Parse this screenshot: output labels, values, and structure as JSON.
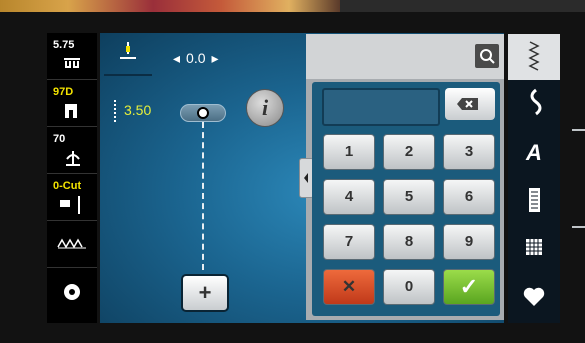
{
  "sidebar": {
    "items": [
      {
        "top": "5.75",
        "icon": "presser-foot-pressure-icon",
        "glyph": "ꝏ"
      },
      {
        "top": "97D",
        "icon": "presser-foot-icon",
        "glyph": "▐▌"
      },
      {
        "top": "70",
        "icon": "thread-tension-icon",
        "glyph": "⍭"
      },
      {
        "top": "0-Cut",
        "icon": "cutter-needle-icon",
        "glyph": "▭ ǀ"
      },
      {
        "top": "",
        "icon": "feed-dog-icon",
        "glyph": "⋀⋀⋀"
      },
      {
        "top": "",
        "icon": "bobbin-icon",
        "glyph": "◎"
      }
    ]
  },
  "needle_position": {
    "value": "0.0"
  },
  "stitch_width": {
    "value": "3.50"
  },
  "keypad": {
    "keys": [
      "1",
      "2",
      "3",
      "4",
      "5",
      "6",
      "7",
      "8",
      "9",
      "✕",
      "0",
      "✓"
    ],
    "display_value": ""
  },
  "categories": [
    {
      "icon": "zigzag-stitch-icon",
      "glyph": "≷"
    },
    {
      "icon": "decorative-stitch-icon",
      "glyph": "ϟ"
    },
    {
      "icon": "alphabet-icon",
      "glyph": "A"
    },
    {
      "icon": "buttonhole-icon",
      "glyph": "▤"
    },
    {
      "icon": "quilt-stitch-icon",
      "glyph": "▩"
    },
    {
      "icon": "personal-program-icon",
      "glyph": "♥"
    }
  ],
  "colors": {
    "accent": "#f2e200",
    "panel": "#1b6590",
    "ok": "#5aa520",
    "cancel": "#c0391a"
  }
}
